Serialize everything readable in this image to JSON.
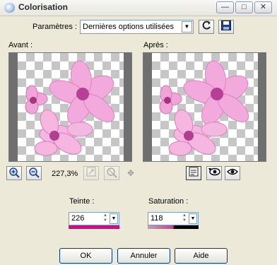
{
  "window": {
    "title": "Colorisation",
    "controls": {
      "minimize": "—",
      "maximize": "□",
      "close": "✕"
    }
  },
  "params": {
    "label": "Paramètres :",
    "selected": "Dernières options utilisées",
    "icons": {
      "reset": "reset-icon",
      "save": "floppy-disk-icon"
    }
  },
  "preview": {
    "before_label": "Avant :",
    "after_label": "Après :"
  },
  "zoom": {
    "level": "227,3%",
    "icons": [
      "zoom-in-icon",
      "zoom-out-icon",
      "fit-icon",
      "actual-size-icon",
      "pan-icon"
    ]
  },
  "hue": {
    "label": "Teinte :",
    "value": "226",
    "color": "#e5008a"
  },
  "saturation": {
    "label": "Saturation :",
    "value": "118"
  },
  "buttons": {
    "ok": "OK",
    "cancel": "Annuler",
    "help": "Aide"
  },
  "colors": {
    "dialog_bg": "#ece9d8",
    "flower_pink": "#f2a9dc",
    "flower_center": "#b83f96"
  }
}
